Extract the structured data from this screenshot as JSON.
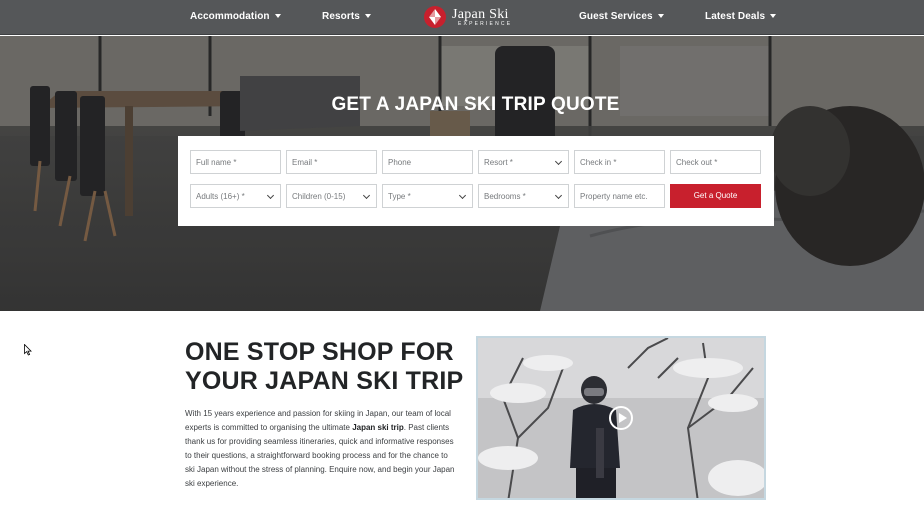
{
  "nav": {
    "items": [
      {
        "label": "Accommodation"
      },
      {
        "label": "Resorts"
      },
      {
        "label": "Guest Services"
      },
      {
        "label": "Latest Deals"
      }
    ],
    "logo": {
      "text": "Japan Ski",
      "subtext": "EXPERIENCE",
      "icon": "logo-diamond-icon"
    }
  },
  "hero": {
    "title": "GET A JAPAN SKI TRIP QUOTE",
    "form": {
      "row1": [
        {
          "placeholder": "Full name *",
          "type": "input"
        },
        {
          "placeholder": "Email *",
          "type": "input"
        },
        {
          "placeholder": "Phone",
          "type": "input"
        },
        {
          "placeholder": "Resort *",
          "type": "select"
        },
        {
          "placeholder": "Check in *",
          "type": "input"
        },
        {
          "placeholder": "Check out *",
          "type": "input"
        }
      ],
      "row2": [
        {
          "placeholder": "Adults (16+) *",
          "type": "select"
        },
        {
          "placeholder": "Children (0-15)",
          "type": "select"
        },
        {
          "placeholder": "Type *",
          "type": "select"
        },
        {
          "placeholder": "Bedrooms *",
          "type": "select"
        },
        {
          "placeholder": "Property name etc.",
          "type": "input"
        }
      ],
      "submit_label": "Get a Quote"
    }
  },
  "content": {
    "title_line1": "ONE STOP SHOP FOR",
    "title_line2": "YOUR JAPAN SKI TRIP",
    "body_before": "With 15 years experience and passion for skiing in Japan, our team of local experts is committed to organising the ultimate ",
    "body_bold": "Japan ski trip",
    "body_after": ". Past clients thank us for providing seamless itineraries, quick and informative responses to their questions, a straightforward booking process and for the chance to ski Japan without the stress of planning. Enquire now, and begin your Japan ski experience."
  },
  "video": {
    "icon": "play-icon"
  },
  "colors": {
    "accent": "#c8202d",
    "nav_bg": "#555759",
    "video_border": "#c5d7e0"
  }
}
